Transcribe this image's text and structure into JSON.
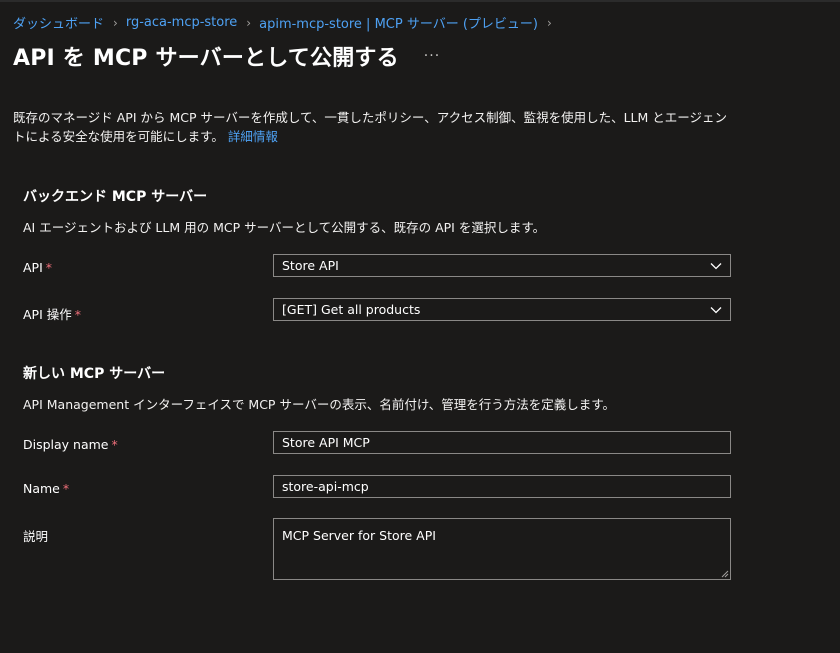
{
  "breadcrumb": [
    {
      "label": "ダッシュボード"
    },
    {
      "label": "rg-aca-mcp-store"
    },
    {
      "label": "apim-mcp-store | MCP サーバー (プレビュー)"
    }
  ],
  "header": {
    "title": "API を MCP サーバーとして公開する",
    "more_label": "···"
  },
  "intro": {
    "text": "既存のマネージド API から MCP サーバーを作成して、一貫したポリシー、アクセス制御、監視を使用した、LLM とエージェントによる安全な使用を可能にします。",
    "link": "詳細情報"
  },
  "backend_section": {
    "title": "バックエンド MCP サーバー",
    "description": "AI エージェントおよび LLM 用の MCP サーバーとして公開する、既存の API を選択します。",
    "api_label": "API",
    "api_value": "Store API",
    "operation_label": "API 操作",
    "operation_value": "[GET] Get all products",
    "required_mark": "*"
  },
  "new_section": {
    "title": "新しい MCP サーバー",
    "description": "API Management インターフェイスで MCP サーバーの表示、名前付け、管理を行う方法を定義します。",
    "display_name_label": "Display name",
    "display_name_value": "Store API MCP",
    "name_label": "Name",
    "name_value": "store-api-mcp",
    "description_label": "説明",
    "description_value": "MCP Server for Store API",
    "required_mark": "*"
  },
  "colors": {
    "background": "#1b1a19",
    "link": "#4ea1f3",
    "required": "#f1707b",
    "border": "#8a8886"
  },
  "icons": [
    "chevron-right-icon",
    "chevron-down-icon",
    "resize-grip-icon",
    "more-icon"
  ]
}
